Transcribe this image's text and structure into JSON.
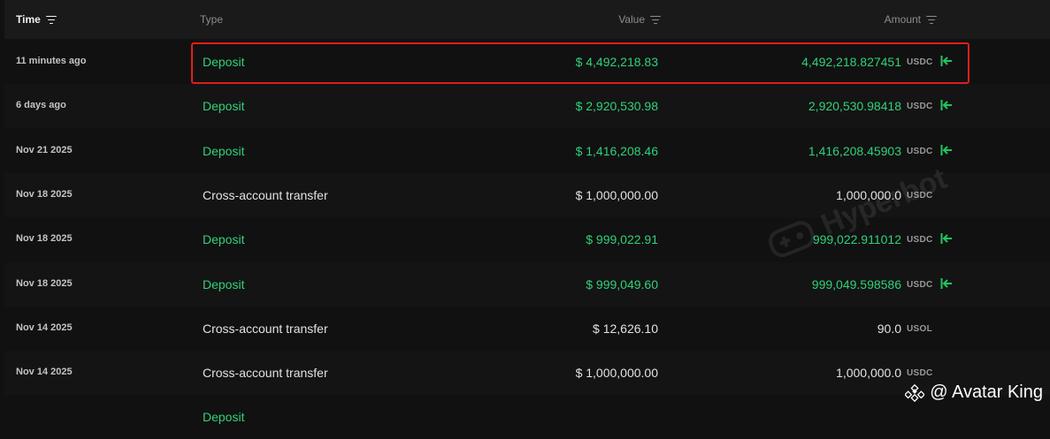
{
  "header": {
    "time_label": "Time",
    "type_label": "Type",
    "value_label": "Value",
    "amount_label": "Amount"
  },
  "rows": [
    {
      "time": "11 minutes ago",
      "type": "Deposit",
      "value": "$ 4,492,218.83",
      "amount": "4,492,218.827451",
      "unit": "USDC",
      "kind": "deposit",
      "arrow": true
    },
    {
      "time": "6 days ago",
      "type": "Deposit",
      "value": "$ 2,920,530.98",
      "amount": "2,920,530.98418",
      "unit": "USDC",
      "kind": "deposit",
      "arrow": true
    },
    {
      "time": "Nov 21 2025",
      "type": "Deposit",
      "value": "$ 1,416,208.46",
      "amount": "1,416,208.45903",
      "unit": "USDC",
      "kind": "deposit",
      "arrow": true
    },
    {
      "time": "Nov 18 2025",
      "type": "Cross-account transfer",
      "value": "$ 1,000,000.00",
      "amount": "1,000,000.0",
      "unit": "USDC",
      "kind": "transfer",
      "arrow": false
    },
    {
      "time": "Nov 18 2025",
      "type": "Deposit",
      "value": "$ 999,022.91",
      "amount": "999,022.911012",
      "unit": "USDC",
      "kind": "deposit",
      "arrow": true
    },
    {
      "time": "Nov 18 2025",
      "type": "Deposit",
      "value": "$ 999,049.60",
      "amount": "999,049.598586",
      "unit": "USDC",
      "kind": "deposit",
      "arrow": true
    },
    {
      "time": "Nov 14 2025",
      "type": "Cross-account transfer",
      "value": "$ 12,626.10",
      "amount": "90.0",
      "unit": "USOL",
      "kind": "transfer",
      "arrow": false
    },
    {
      "time": "Nov 14 2025",
      "type": "Cross-account transfer",
      "value": "$ 1,000,000.00",
      "amount": "1,000,000.0",
      "unit": "USDC",
      "kind": "transfer",
      "arrow": false
    },
    {
      "time": "",
      "type": "Deposit",
      "value": "",
      "amount": "",
      "unit": "",
      "kind": "deposit",
      "arrow": false
    }
  ],
  "watermark": "Hyperbot",
  "brand": "@ Avatar King",
  "colors": {
    "deposit": "#2fd27a",
    "transfer": "#e2e2e2",
    "highlight": "#e11d1d"
  }
}
